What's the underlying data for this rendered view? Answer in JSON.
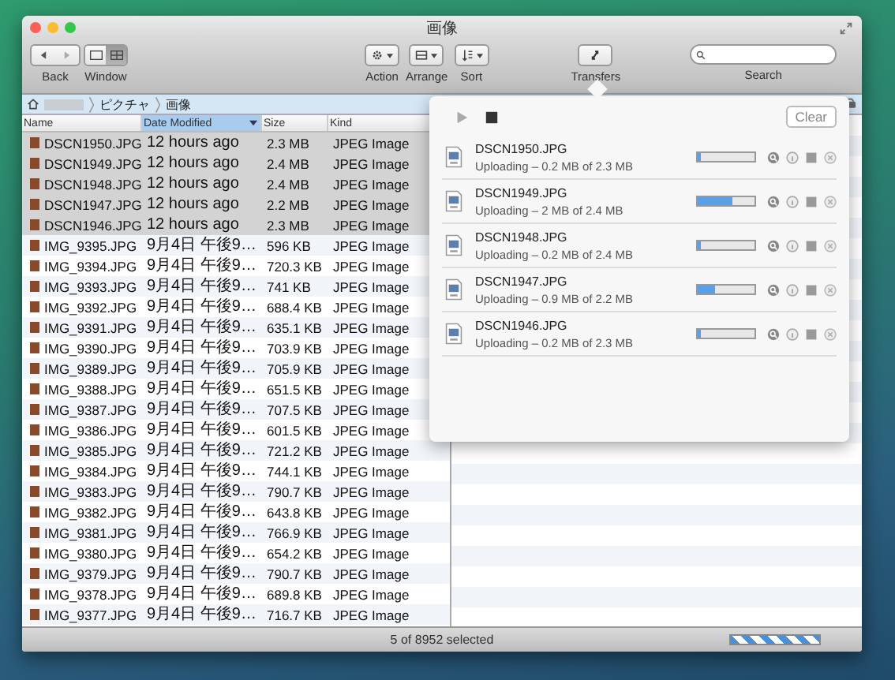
{
  "window": {
    "title": "画像"
  },
  "toolbar": [
    {
      "kind": "history",
      "label": "Back"
    },
    {
      "kind": "view",
      "label": "Window",
      "views": [
        {
          "selected": false
        },
        {
          "selected": true
        }
      ]
    },
    {
      "kind": "action",
      "label": "Action"
    },
    {
      "kind": "arrange",
      "label": "Arrange"
    },
    {
      "kind": "sort",
      "label": "Sort"
    },
    {
      "kind": "transfers",
      "label": "Transfers"
    },
    {
      "kind": "search",
      "label": "Search"
    }
  ],
  "path": {
    "segments": [
      "ピクチャ",
      "画像"
    ]
  },
  "columns": [
    {
      "label": "Name",
      "selected": false
    },
    {
      "label": "Date Modified",
      "selected": true
    },
    {
      "label": "Size",
      "selected": false
    },
    {
      "label": "Kind",
      "selected": false
    }
  ],
  "rows": [
    {
      "name": "DSCN1950.JPG",
      "date": "12 hours ago",
      "size": "2.3 MB",
      "kind": "JPEG Image",
      "selected": true
    },
    {
      "name": "DSCN1949.JPG",
      "date": "12 hours ago",
      "size": "2.4 MB",
      "kind": "JPEG Image",
      "selected": true
    },
    {
      "name": "DSCN1948.JPG",
      "date": "12 hours ago",
      "size": "2.4 MB",
      "kind": "JPEG Image",
      "selected": true
    },
    {
      "name": "DSCN1947.JPG",
      "date": "12 hours ago",
      "size": "2.2 MB",
      "kind": "JPEG Image",
      "selected": true
    },
    {
      "name": "DSCN1946.JPG",
      "date": "12 hours ago",
      "size": "2.3 MB",
      "kind": "JPEG Image",
      "selected": true
    },
    {
      "name": "IMG_9395.JPG",
      "date": "9月4日 午後9…",
      "size": "596 KB",
      "kind": "JPEG Image",
      "selected": false
    },
    {
      "name": "IMG_9394.JPG",
      "date": "9月4日 午後9…",
      "size": "720.3 KB",
      "kind": "JPEG Image",
      "selected": false
    },
    {
      "name": "IMG_9393.JPG",
      "date": "9月4日 午後9…",
      "size": "741 KB",
      "kind": "JPEG Image",
      "selected": false
    },
    {
      "name": "IMG_9392.JPG",
      "date": "9月4日 午後9…",
      "size": "688.4 KB",
      "kind": "JPEG Image",
      "selected": false
    },
    {
      "name": "IMG_9391.JPG",
      "date": "9月4日 午後9…",
      "size": "635.1 KB",
      "kind": "JPEG Image",
      "selected": false
    },
    {
      "name": "IMG_9390.JPG",
      "date": "9月4日 午後9…",
      "size": "703.9 KB",
      "kind": "JPEG Image",
      "selected": false
    },
    {
      "name": "IMG_9389.JPG",
      "date": "9月4日 午後9…",
      "size": "705.9 KB",
      "kind": "JPEG Image",
      "selected": false
    },
    {
      "name": "IMG_9388.JPG",
      "date": "9月4日 午後9…",
      "size": "651.5 KB",
      "kind": "JPEG Image",
      "selected": false
    },
    {
      "name": "IMG_9387.JPG",
      "date": "9月4日 午後9…",
      "size": "707.5 KB",
      "kind": "JPEG Image",
      "selected": false
    },
    {
      "name": "IMG_9386.JPG",
      "date": "9月4日 午後9…",
      "size": "601.5 KB",
      "kind": "JPEG Image",
      "selected": false
    },
    {
      "name": "IMG_9385.JPG",
      "date": "9月4日 午後9…",
      "size": "721.2 KB",
      "kind": "JPEG Image",
      "selected": false
    },
    {
      "name": "IMG_9384.JPG",
      "date": "9月4日 午後9…",
      "size": "744.1 KB",
      "kind": "JPEG Image",
      "selected": false
    },
    {
      "name": "IMG_9383.JPG",
      "date": "9月4日 午後9…",
      "size": "790.7 KB",
      "kind": "JPEG Image",
      "selected": false
    },
    {
      "name": "IMG_9382.JPG",
      "date": "9月4日 午後9…",
      "size": "643.8 KB",
      "kind": "JPEG Image",
      "selected": false
    },
    {
      "name": "IMG_9381.JPG",
      "date": "9月4日 午後9…",
      "size": "766.9 KB",
      "kind": "JPEG Image",
      "selected": false
    },
    {
      "name": "IMG_9380.JPG",
      "date": "9月4日 午後9…",
      "size": "654.2 KB",
      "kind": "JPEG Image",
      "selected": false
    },
    {
      "name": "IMG_9379.JPG",
      "date": "9月4日 午後9…",
      "size": "790.7 KB",
      "kind": "JPEG Image",
      "selected": false
    },
    {
      "name": "IMG_9378.JPG",
      "date": "9月4日 午後9…",
      "size": "689.8 KB",
      "kind": "JPEG Image",
      "selected": false
    },
    {
      "name": "IMG_9377.JPG",
      "date": "9月4日 午後9…",
      "size": "716.7 KB",
      "kind": "JPEG Image",
      "selected": false
    }
  ],
  "transfers": {
    "play": {
      "disabled": true
    },
    "stop": {
      "disabled": false
    },
    "clear": "Clear",
    "items": [
      {
        "name": "DSCN1950.JPG",
        "status": "Uploading – 0.2 MB of 2.3 MB",
        "level": 0.05
      },
      {
        "name": "DSCN1949.JPG",
        "status": "Uploading – 2 MB of 2.4 MB",
        "level": 0.6
      },
      {
        "name": "DSCN1948.JPG",
        "status": "Uploading – 0.2 MB of 2.4 MB",
        "level": 0.05
      },
      {
        "name": "DSCN1947.JPG",
        "status": "Uploading – 0.9 MB of 2.2 MB",
        "level": 0.3
      },
      {
        "name": "DSCN1946.JPG",
        "status": "Uploading – 0.2 MB of 2.3 MB",
        "level": 0.05
      }
    ]
  },
  "status_bar": {
    "text": "5 of 8952 selected"
  }
}
